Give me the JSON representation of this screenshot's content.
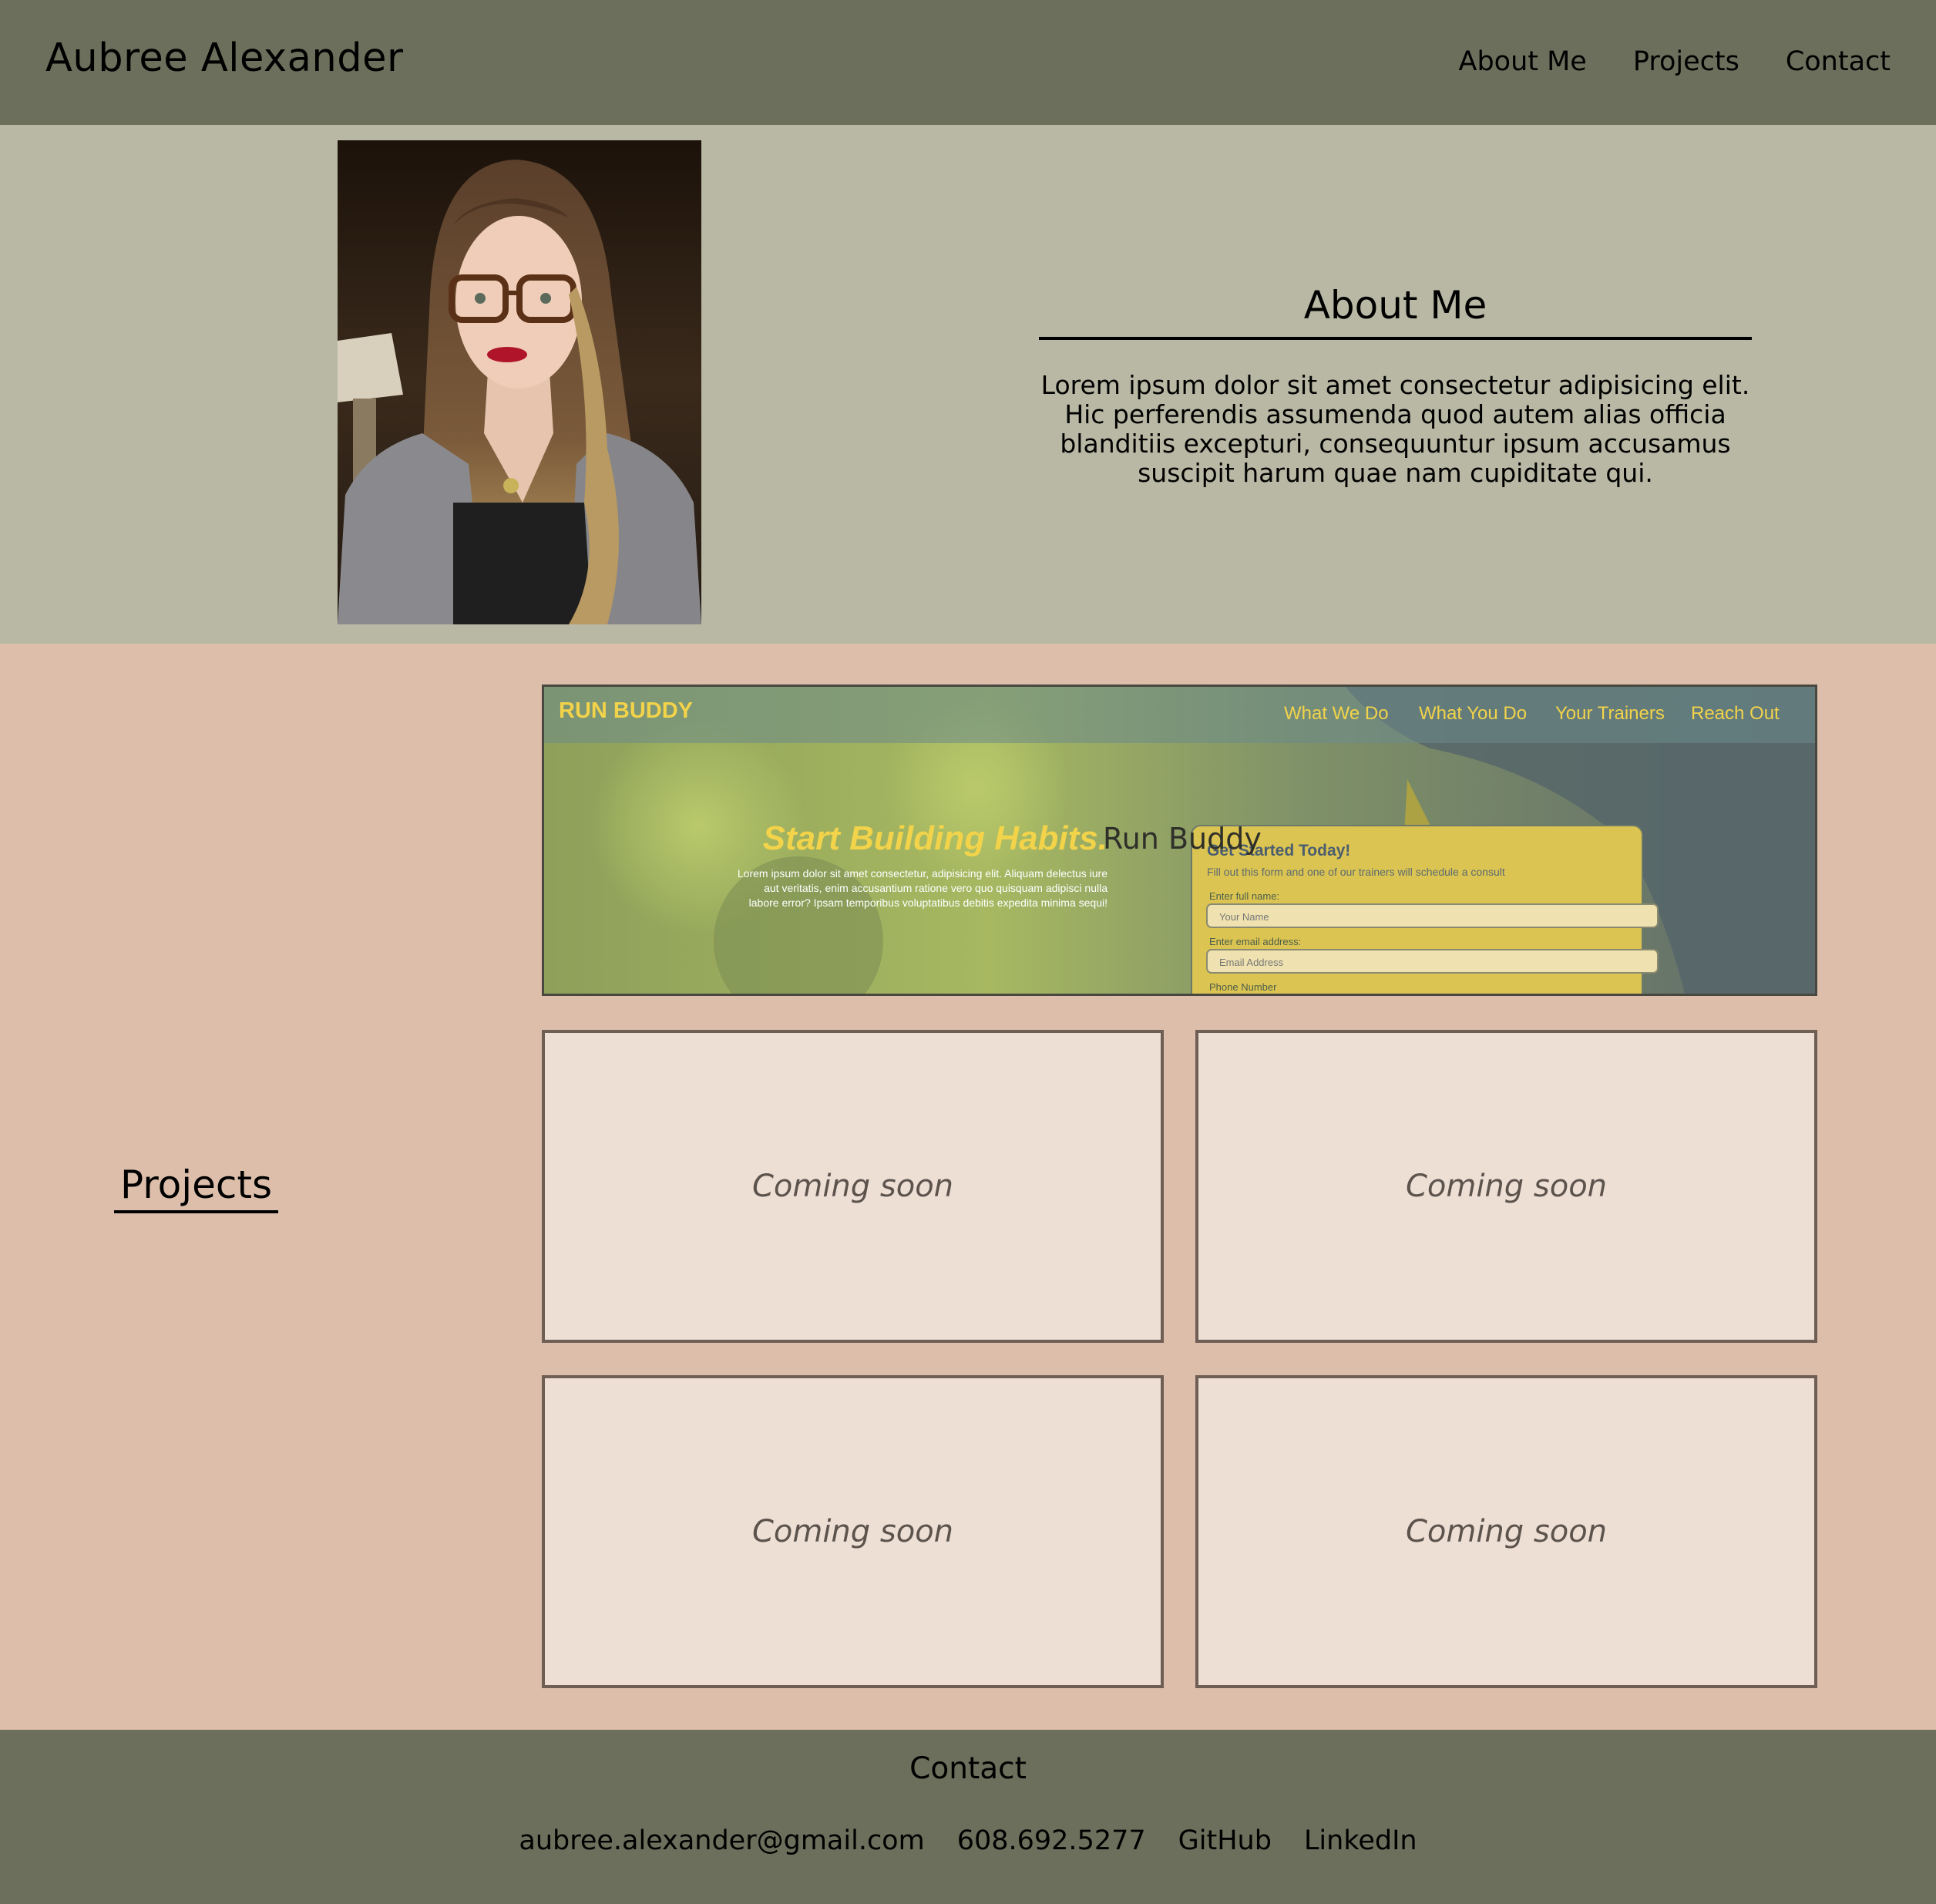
{
  "header": {
    "site_name": "Aubree Alexander",
    "nav": [
      "About Me",
      "Projects",
      "Contact"
    ]
  },
  "about": {
    "title": "About Me",
    "body": "Lorem ipsum dolor sit amet consectetur adipisicing elit. Hic perferendis assumenda quod autem alias officia blanditiis excepturi, consequuntur ipsum accusamus suscipit harum quae nam cupiditate qui."
  },
  "projects": {
    "title": "Projects",
    "featured": {
      "label": "Run Buddy",
      "screenshot": {
        "brand": "RUN BUDDY",
        "nav": [
          "What We Do",
          "What You Do",
          "Your Trainers",
          "Reach Out"
        ],
        "headline": "Start Building Habits.",
        "blurb": [
          "Lorem ipsum dolor sit amet consectetur, adipisicing elit. Aliquam delectus iure",
          "aut veritatis, enim accusantium ratione vero quo quisquam adipisci nulla",
          "labore error? Ipsam temporibus voluptatibus debitis expedita minima sequi!"
        ],
        "form_title": "Get Started Today!",
        "form_subtitle": "Fill out this form and one of our trainers will schedule a consult",
        "name_label": "Enter full name:",
        "name_placeholder": "Your Name",
        "email_label": "Enter email address:",
        "email_placeholder": "Email Address",
        "phone_label": "Phone Number"
      }
    },
    "cards": [
      "Coming soon",
      "Coming soon",
      "Coming soon",
      "Coming soon"
    ]
  },
  "footer": {
    "title": "Contact",
    "links": [
      "aubree.alexander@gmail.com",
      "608.692.5277",
      "GitHub",
      "LinkedIn"
    ]
  },
  "colors": {
    "header_bg": "#6b6f5b",
    "about_bg": "#b8b8a4",
    "projects_bg": "#dcbeaa",
    "card_bg": "#eedfd5",
    "card_border": "#6e5e54",
    "runbuddy_yellow": "#f2d34a"
  }
}
